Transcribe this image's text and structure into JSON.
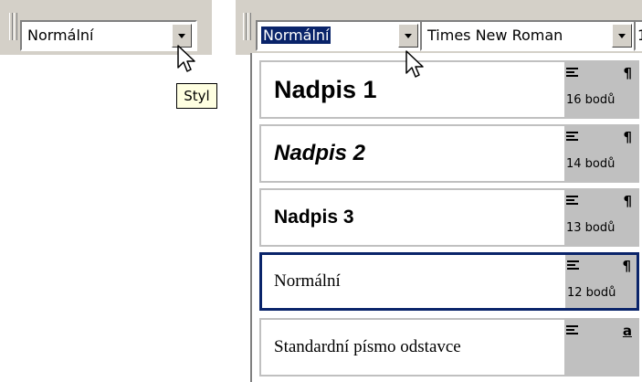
{
  "left_toolbar": {
    "style_combo": {
      "value": "Normální"
    },
    "tooltip": "Styl"
  },
  "right_toolbar": {
    "style_combo": {
      "value": "Normální"
    },
    "font_combo": {
      "value": "Times New Roman"
    },
    "size_combo": {
      "value": "1"
    }
  },
  "style_list": [
    {
      "name": "Nadpis 1",
      "paragraph_mark": "¶",
      "size": "16 bodů",
      "selected": false
    },
    {
      "name": "Nadpis 2",
      "paragraph_mark": "¶",
      "size": "14 bodů",
      "selected": false
    },
    {
      "name": "Nadpis 3",
      "paragraph_mark": "¶",
      "size": "13 bodů",
      "selected": false
    },
    {
      "name": "Normální",
      "paragraph_mark": "¶",
      "size": "12 bodů",
      "selected": true
    },
    {
      "name": "Standardní písmo odstavce",
      "paragraph_mark": "a",
      "size": "",
      "selected": false
    }
  ],
  "icons": {
    "alignment": "align-left-icon",
    "paragraph_style": "pilcrow-icon",
    "character_style": "character-style-icon",
    "dropdown": "chevron-down-icon",
    "cursor": "mouse-pointer-icon"
  },
  "colors": {
    "face": "#d4d0c8",
    "selection": "#0a246a",
    "tooltip_bg": "#ffffe1",
    "style_info_bg": "#c0c0c0"
  }
}
